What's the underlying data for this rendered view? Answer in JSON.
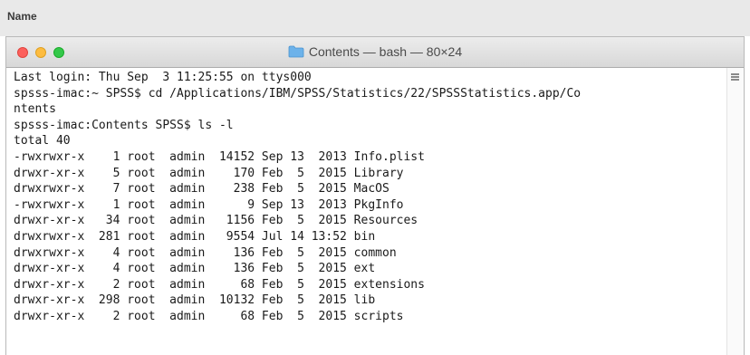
{
  "finder": {
    "column_header": "Name"
  },
  "window": {
    "title": "Contents — bash — 80×24",
    "folder_icon_color": "#6cb2ea"
  },
  "terminal": {
    "lines": [
      "Last login: Thu Sep  3 11:25:55 on ttys000",
      "spsss-imac:~ SPSS$ cd /Applications/IBM/SPSS/Statistics/22/SPSSStatistics.app/Co",
      "ntents",
      "spsss-imac:Contents SPSS$ ls -l",
      "total 40",
      "-rwxrwxr-x    1 root  admin  14152 Sep 13  2013 Info.plist",
      "drwxr-xr-x    5 root  admin    170 Feb  5  2015 Library",
      "drwxrwxr-x    7 root  admin    238 Feb  5  2015 MacOS",
      "-rwxrwxr-x    1 root  admin      9 Sep 13  2013 PkgInfo",
      "drwxr-xr-x   34 root  admin   1156 Feb  5  2015 Resources",
      "drwxrwxr-x  281 root  admin   9554 Jul 14 13:52 bin",
      "drwxrwxr-x    4 root  admin    136 Feb  5  2015 common",
      "drwxr-xr-x    4 root  admin    136 Feb  5  2015 ext",
      "drwxr-xr-x    2 root  admin     68 Feb  5  2015 extensions",
      "drwxr-xr-x  298 root  admin  10132 Feb  5  2015 lib",
      "drwxr-xr-x    2 root  admin     68 Feb  5  2015 scripts"
    ]
  }
}
